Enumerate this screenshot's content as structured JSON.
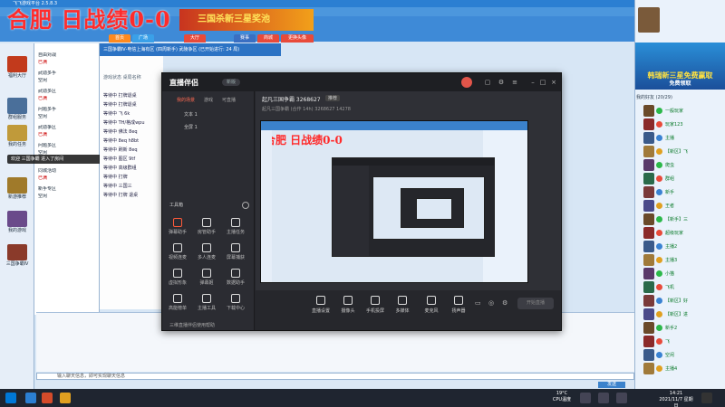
{
  "app": {
    "window_title": "飞飞游戏平台 2.5.8.3",
    "brand_overlay": "合肥 日战绩0-0",
    "promo_banner": "三国杀新三星奖池",
    "room_header": "三国争霸Ⅳ-电信上海有区 (四周新手) 武陵争区 (已开始进行: 24 局)",
    "tabs": [
      "首页",
      "广场",
      "大厅",
      "赛事",
      "商城",
      "更换头像"
    ]
  },
  "left_bar": {
    "items": [
      "福利大厅",
      "群组服务",
      "我的任务",
      "新游推荐",
      "我的游戏",
      "三国争霸Ⅳ"
    ]
  },
  "room_list": {
    "rows": [
      "自由对战",
      "已满",
      "武勋多手",
      "空闲",
      "武勋多区",
      "已满",
      "问题多手",
      "空闲",
      "武勋争区",
      "已满",
      "问题多区",
      "空闲",
      "同城活动",
      "已满",
      "新手专区",
      "空闲"
    ]
  },
  "table_list": {
    "header": [
      "游戏状态",
      "桌局名称"
    ],
    "rows": [
      "等待中 打牌退桌",
      "等待中 打牌退桌",
      "等待中 飞 6k",
      "等待中 TH/格成wpu",
      "等待中 佛法 8eq",
      "等待中 8eq h8bt",
      "等待中 刷新 8eq",
      "等待中 图区 9tf",
      "等待中 高级群组",
      "等待中 打牌",
      "等待中 三国三",
      "等待中 打牌 退桌"
    ]
  },
  "notification": {
    "text": "欢迎 三国争霸 进入了房间"
  },
  "right_panel": {
    "banner": "韩瑞新三星免费赢取",
    "banner_sub": "免费领取",
    "list_title": "我的好友 (20/29)",
    "players": [
      "一般玩家",
      "玩家123",
      "主播",
      "【新区】飞",
      "爬虫",
      "群组",
      "新手",
      "王者",
      "【新手】三",
      "超级玩家",
      "主播2",
      "主播3",
      "小猫",
      "飞机",
      "【新区】好",
      "【新区】进",
      "新手2",
      "飞",
      "空闲",
      "主播4"
    ]
  },
  "chat": {
    "input_placeholder": "输入聊天信息，即可实现聊天信息",
    "send_label": "发送"
  },
  "stream_app": {
    "logo": "直播伴侣",
    "version": "新版",
    "subtabs": [
      "我的场景",
      "游戏",
      "可直播"
    ],
    "scenes": [
      "文本 1",
      "全屏 1"
    ],
    "section_tools": "工具箱",
    "tools": [
      "弹幕助手",
      "房管助手",
      "主播任务",
      "视频连麦",
      "多人连麦",
      "屏幕捕获",
      "虚拟形象",
      "弹幕姬",
      "数据助手",
      "高能榜单",
      "主播工具",
      "下载中心"
    ],
    "room_name": "起凡三国争霸 3268627",
    "room_tag": "推荐",
    "room_sub": "起凡三国争霸 (合作 14h) 3268627   14278",
    "bottom_buttons": [
      "直播设置",
      "摄像头",
      "手机投屏",
      "多媒体",
      "麦克风",
      "扬声器"
    ],
    "golive_label": "开始直播",
    "footer_hint": "三维直播伴侣使用帮助"
  },
  "taskbar": {
    "temp": "19°C",
    "temp_label": "CPU温度",
    "clock_time": "14:21",
    "clock_date": "2021/11/7 星期日"
  },
  "colors": {
    "chrome_blue": "#2b7fd2",
    "accent_red": "#ff2b2b",
    "stream_dark": "#25262b",
    "player_green": "#0a7a2a"
  }
}
